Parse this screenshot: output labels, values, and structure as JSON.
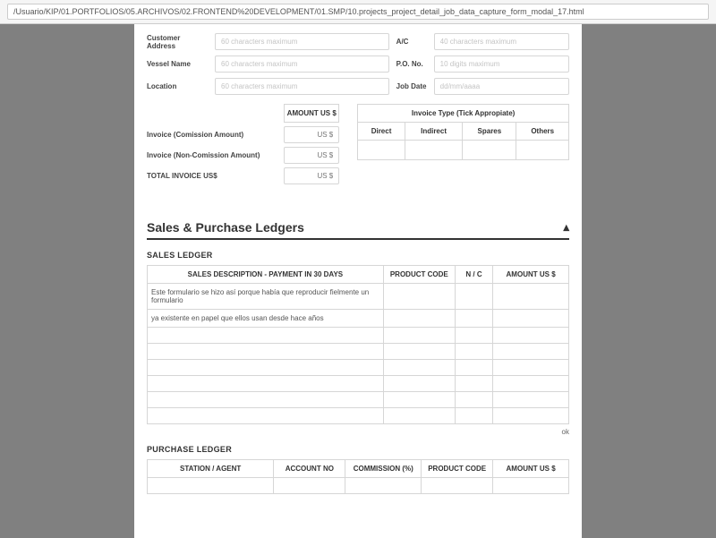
{
  "url": "/Usuario/KIP/01.PORTFOLIOS/05.ARCHIVOS/02.FRONTEND%20DEVELOPMENT/01.SMP/10.projects_project_detail_job_data_capture_form_modal_17.html",
  "top_form": {
    "left": [
      {
        "label": "Customer Address",
        "placeholder": "60 characters maximum"
      },
      {
        "label": "Vessel Name",
        "placeholder": "60 characters maximum"
      },
      {
        "label": "Location",
        "placeholder": "60 characters maximum"
      }
    ],
    "right": [
      {
        "label": "A/C",
        "placeholder": "40 characters maximum"
      },
      {
        "label": "P.O. No.",
        "placeholder": "10 digits maximum"
      },
      {
        "label": "Job Date",
        "placeholder": "dd/mm/aaaa"
      }
    ]
  },
  "amounts": {
    "header": "AMOUNT US $",
    "rows": [
      {
        "label": "Invoice (Comission Amount)",
        "placeholder": "US $"
      },
      {
        "label": "Invoice (Non-Comission Amount)",
        "placeholder": "US $"
      },
      {
        "label": "TOTAL INVOICE US$",
        "placeholder": "US $"
      }
    ]
  },
  "invoice_type": {
    "title": "Invoice Type (Tick Appropiate)",
    "cols": [
      "Direct",
      "Indirect",
      "Spares",
      "Others"
    ]
  },
  "section": {
    "title": "Sales & Purchase Ledgers"
  },
  "sales_ledger": {
    "title": "SALES LEDGER",
    "headers": [
      "SALES DESCRIPTION - PAYMENT IN 30 DAYS",
      "PRODUCT CODE",
      "N / C",
      "AMOUNT US $"
    ],
    "rows": [
      "Este formulario se hizo así porque había que reproducir fielmente un formulario",
      "ya existente en papel que ellos usan desde hace años",
      "",
      "",
      "",
      "",
      "",
      ""
    ],
    "ok": "ok"
  },
  "purchase_ledger": {
    "title": "PURCHASE LEDGER",
    "headers": [
      "STATION / AGENT",
      "ACCOUNT NO",
      "COMMISSION (%)",
      "PRODUCT CODE",
      "AMOUNT US $"
    ]
  }
}
